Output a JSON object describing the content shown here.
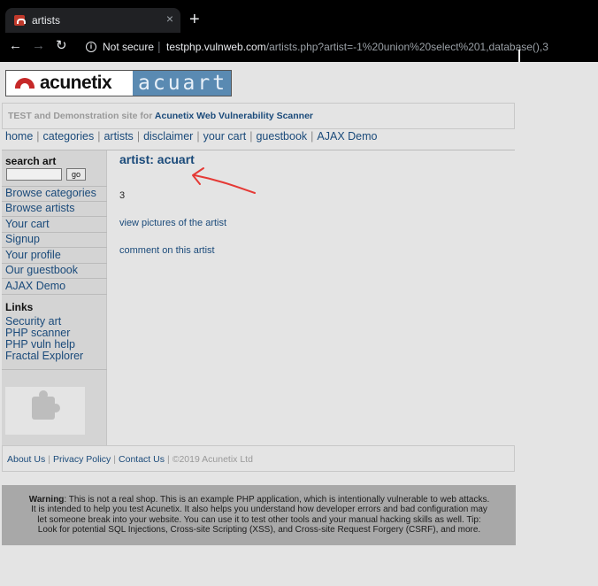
{
  "browser": {
    "tab_title": "artists",
    "tab_close": "×",
    "new_tab": "+",
    "not_secure": "Not secure",
    "url_host": "testphp.vulnweb.com",
    "url_path": "/artists.php?artist=-1%20union%20select%201,database(),3"
  },
  "logo": {
    "brand": "acunetix",
    "art": "acuart"
  },
  "banner": {
    "prefix": "TEST and Demonstration site for ",
    "link": "Acunetix Web Vulnerability Scanner"
  },
  "topnav": {
    "items": [
      "home",
      "categories",
      "artists",
      "disclaimer",
      "your cart",
      "guestbook",
      "AJAX Demo"
    ]
  },
  "sidebar": {
    "search_title": "search art",
    "search_value": "",
    "search_button": "go",
    "menu": [
      "Browse categories",
      "Browse artists",
      "Your cart",
      "Signup",
      "Your profile",
      "Our guestbook",
      "AJAX Demo"
    ],
    "links_title": "Links",
    "links": [
      "Security art",
      "PHP scanner",
      "PHP vuln help",
      "Fractal Explorer"
    ]
  },
  "main": {
    "title": "artist: acuart",
    "value": "3",
    "view_link": "view pictures of the artist",
    "comment_link": "comment on this artist"
  },
  "footer": {
    "about": "About Us",
    "privacy": "Privacy Policy",
    "contact": "Contact Us",
    "copyright": "©2019 Acunetix Ltd"
  },
  "warning": {
    "label": "Warning",
    "line1": ": This is not a real shop. This is an example PHP application, which is intentionally vulnerable to web attacks.",
    "line2": "It is intended to help you test Acunetix. It also helps you understand how developer errors and bad configuration may",
    "line3": "let someone break into your website. You can use it to test other tools and your manual hacking skills as well. Tip:",
    "line4": "Look for potential SQL Injections, Cross-site Scripting (XSS), and Cross-site Request Forgery (CSRF), and more."
  },
  "colors": {
    "link": "#1a4a7a",
    "annotation": "#e53935",
    "page_bg": "#e4e4e4",
    "warning_bg": "#a8a8a8"
  }
}
